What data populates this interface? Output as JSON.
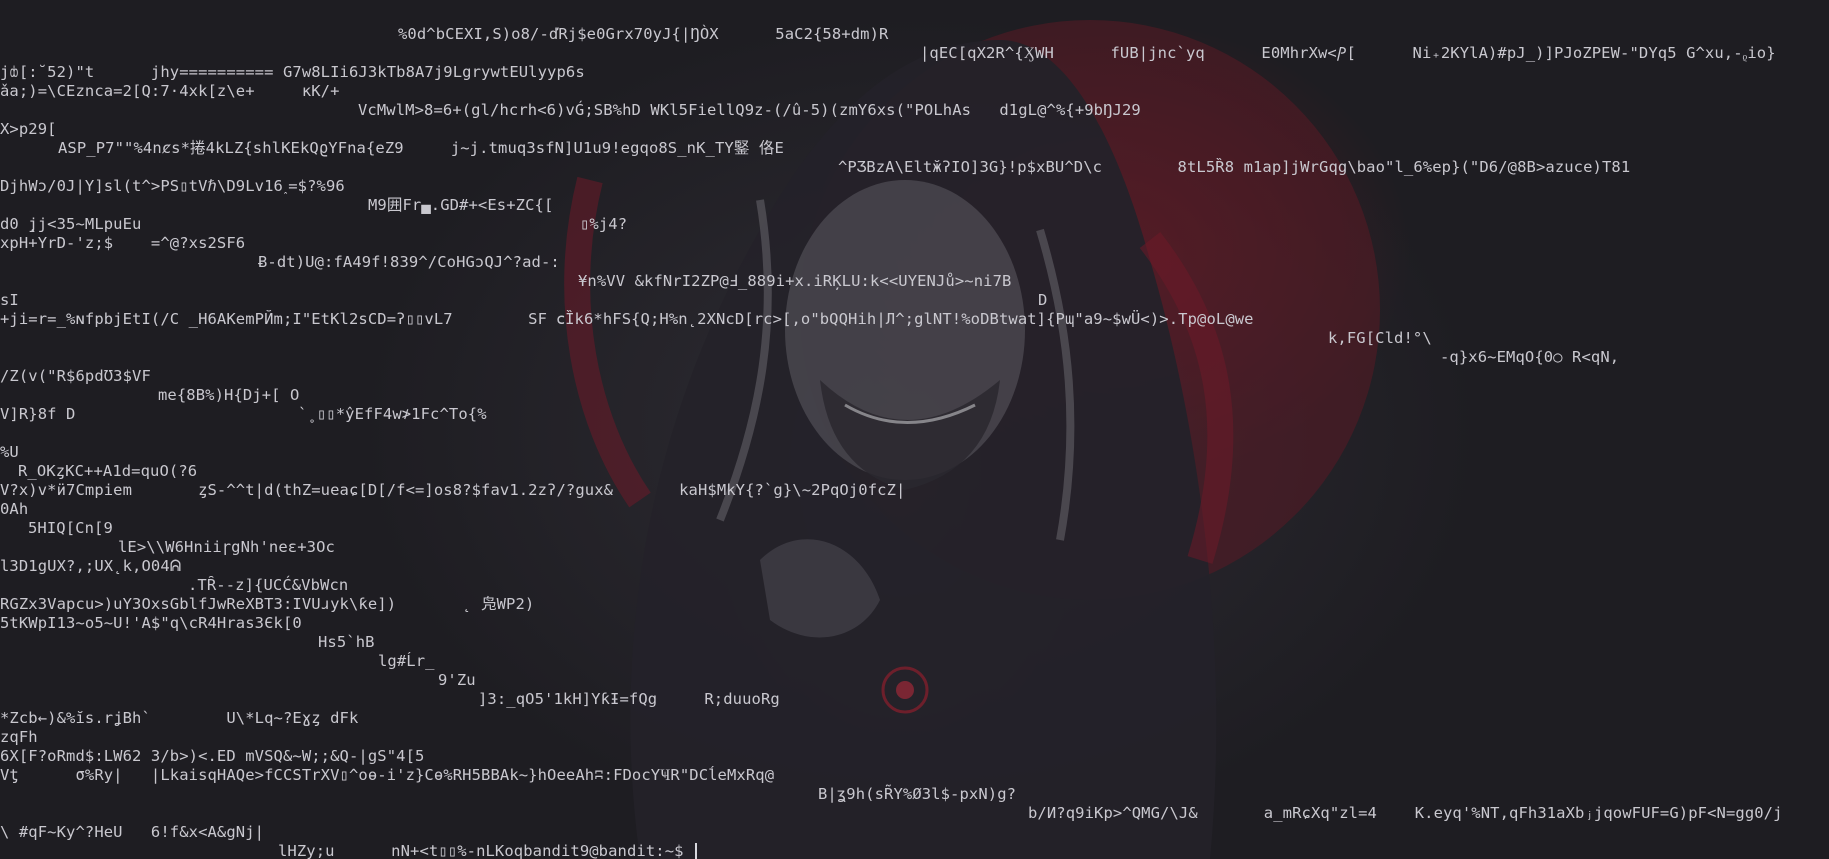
{
  "terminal": {
    "lines": [
      "%0d^bCEXI,S)o8/-ďRj$e0Grx70yJ{|ŊÒX      5aC2{58+dm)R",
      "|qEC[qX2R^{ӼWH      fUB|jnc`yq      E0MhrXw<Ⳏ[      Ni₊2KYlA)#pJ_)]PJoZPEW-\"DYq5 G^xu,-ᵨio}",
      "jȸ[:˘52)\"t      jhy========== G7w8LIi6J3kTb8A7j9LgrywtEUlyyp6s",
      "ǎa;)=\\CEznca=2[Q:7·4xk[z\\e+     ĸK/+",
      "VcMwlM>8=6+(gl/hcrh<6)vǴ;SB%hD WKl5FiellQ9z-(/û-5)(zmY6xs(\"POLhAs   d1gL@^%{+9bŊJ29",
      "X>p29[",
      "ASP_P7\"\"%4nȼs*捲4kLZ{shlKEkQϱYFna{eZ9     j~j.tmuq3sfN]U1u9!egqo8S_nK_TY鋻 佫E",
      "^PƷBzA\\EltӂʔIO]3G}!p$xBU^D\\c        8tL5Ȑ8 m1ap]jWrGqg\\bao\"l_6%ep}(\"D6/@8B>azuce)T81",
      "DjhWɔ/0J|Y]sl(t^>PS▯tVℏ\\D9Lv16˰=$?%96",
      "M9囲Fr▄.GD#+<Es+ZC{[",
      "d0 ̨jj<35~MLpuEu",
      "▯%j4?",
      "xpH+YrD-'z;$    =^@?xs2SF6",
      "Ƀ-dt)U@:fA49f!839^/CoHGɔQJ^?ad-:",
      "¥n%VV &kfNrI2ZP@Ⅎ_889i+x.iRĶLU:k<<UYENJů>~ni7B",
      "D",
      "sI",
      "+ji=r=_%ɴfpbjEtI(/C _H6AKemРЙm;I\"EtKl2sCD=ʔ▯▯vL7        SF ⅽȈk6*hFS{Q;H%n˛2XNcD[rc>[,o\"bQQHih|Л^;glNT!%oDBtwat]{Pɰ\"a9~$wÜ<)>.Tp@oL@we",
      "k,FG[Cld!°\\",
      "-q}x6~EMqO{0○ R<qN,",
      "/Z(v(\"R$6pdƱ3$VF",
      "me{8B%)H{Dj+[ O",
      "V]R}8f D",
      "`˳▯▯*ŷEfF4w≯1Fc^To{%",
      "%U",
      "R_OKȥKC++A1d=quO(?6",
      "V?x)v*ӥ7Cmpiem       ȥS-^^t|d(thZ=ueaɕ[D[/f<=]os8?$fav1.2zʔ/?gux&       kaH$MkY{?`g}\\~2PqOj0fcZ|",
      "0Ah",
      "5HIQ[Cn[9",
      "lE>\\\\W6HniiɼgNh'neɛ+3Oc",
      "l3D1gUX?,;UX˛k,O04ᕱ",
      ".TȒ--z]{UCĆ&VbWcn",
      "RGZx3Vapcu>)uY3OxsGblfJwReXBT3:IVUɹyk\\ƙe])       ˛ 凫WP2)",
      "5tKWpI13~o5~U!'A$\"q\\cR4Hras3Єk[0",
      "Hs5`hB",
      "lg#Ĺr_",
      "9'Zu",
      "]3:_qO5'1kH]YƙƗ=fQg     R;duuoRg",
      "*Zcb←)&%ĭs.rʝBh`        U\\*Lq~?Eɣȥ dFk",
      "zqFh",
      "6X[F?oRmd$:LW62 3/b>)<.ED mVSQ&~W;;&Q-|gS\"4[5",
      "Vƫ      σ%Ry|   |LkaisqHAQe>fCCSTrXV▯^oɵ-i'z}Cɵ%RH5BBAk~}hOeeAhʭ:FDocYҸR\"DCĺeMxRq@",
      "B|ʓ9h(sR̃Y%Ø3l$-pxN)g?",
      "b/И?q9iKp>^QMG/\\J&       a_mRɕXq\"zl=4    K.eyq'%NT,qFh31aXbⱼjqowFUF=G)pF<N=gg0/j",
      "\\ #qF~Ky^?HeU   6!f&x<A&gNj|",
      "lHZy;u_     nN+<t▯▯%-nLKoqbandit9@bandit:~$ "
    ]
  }
}
